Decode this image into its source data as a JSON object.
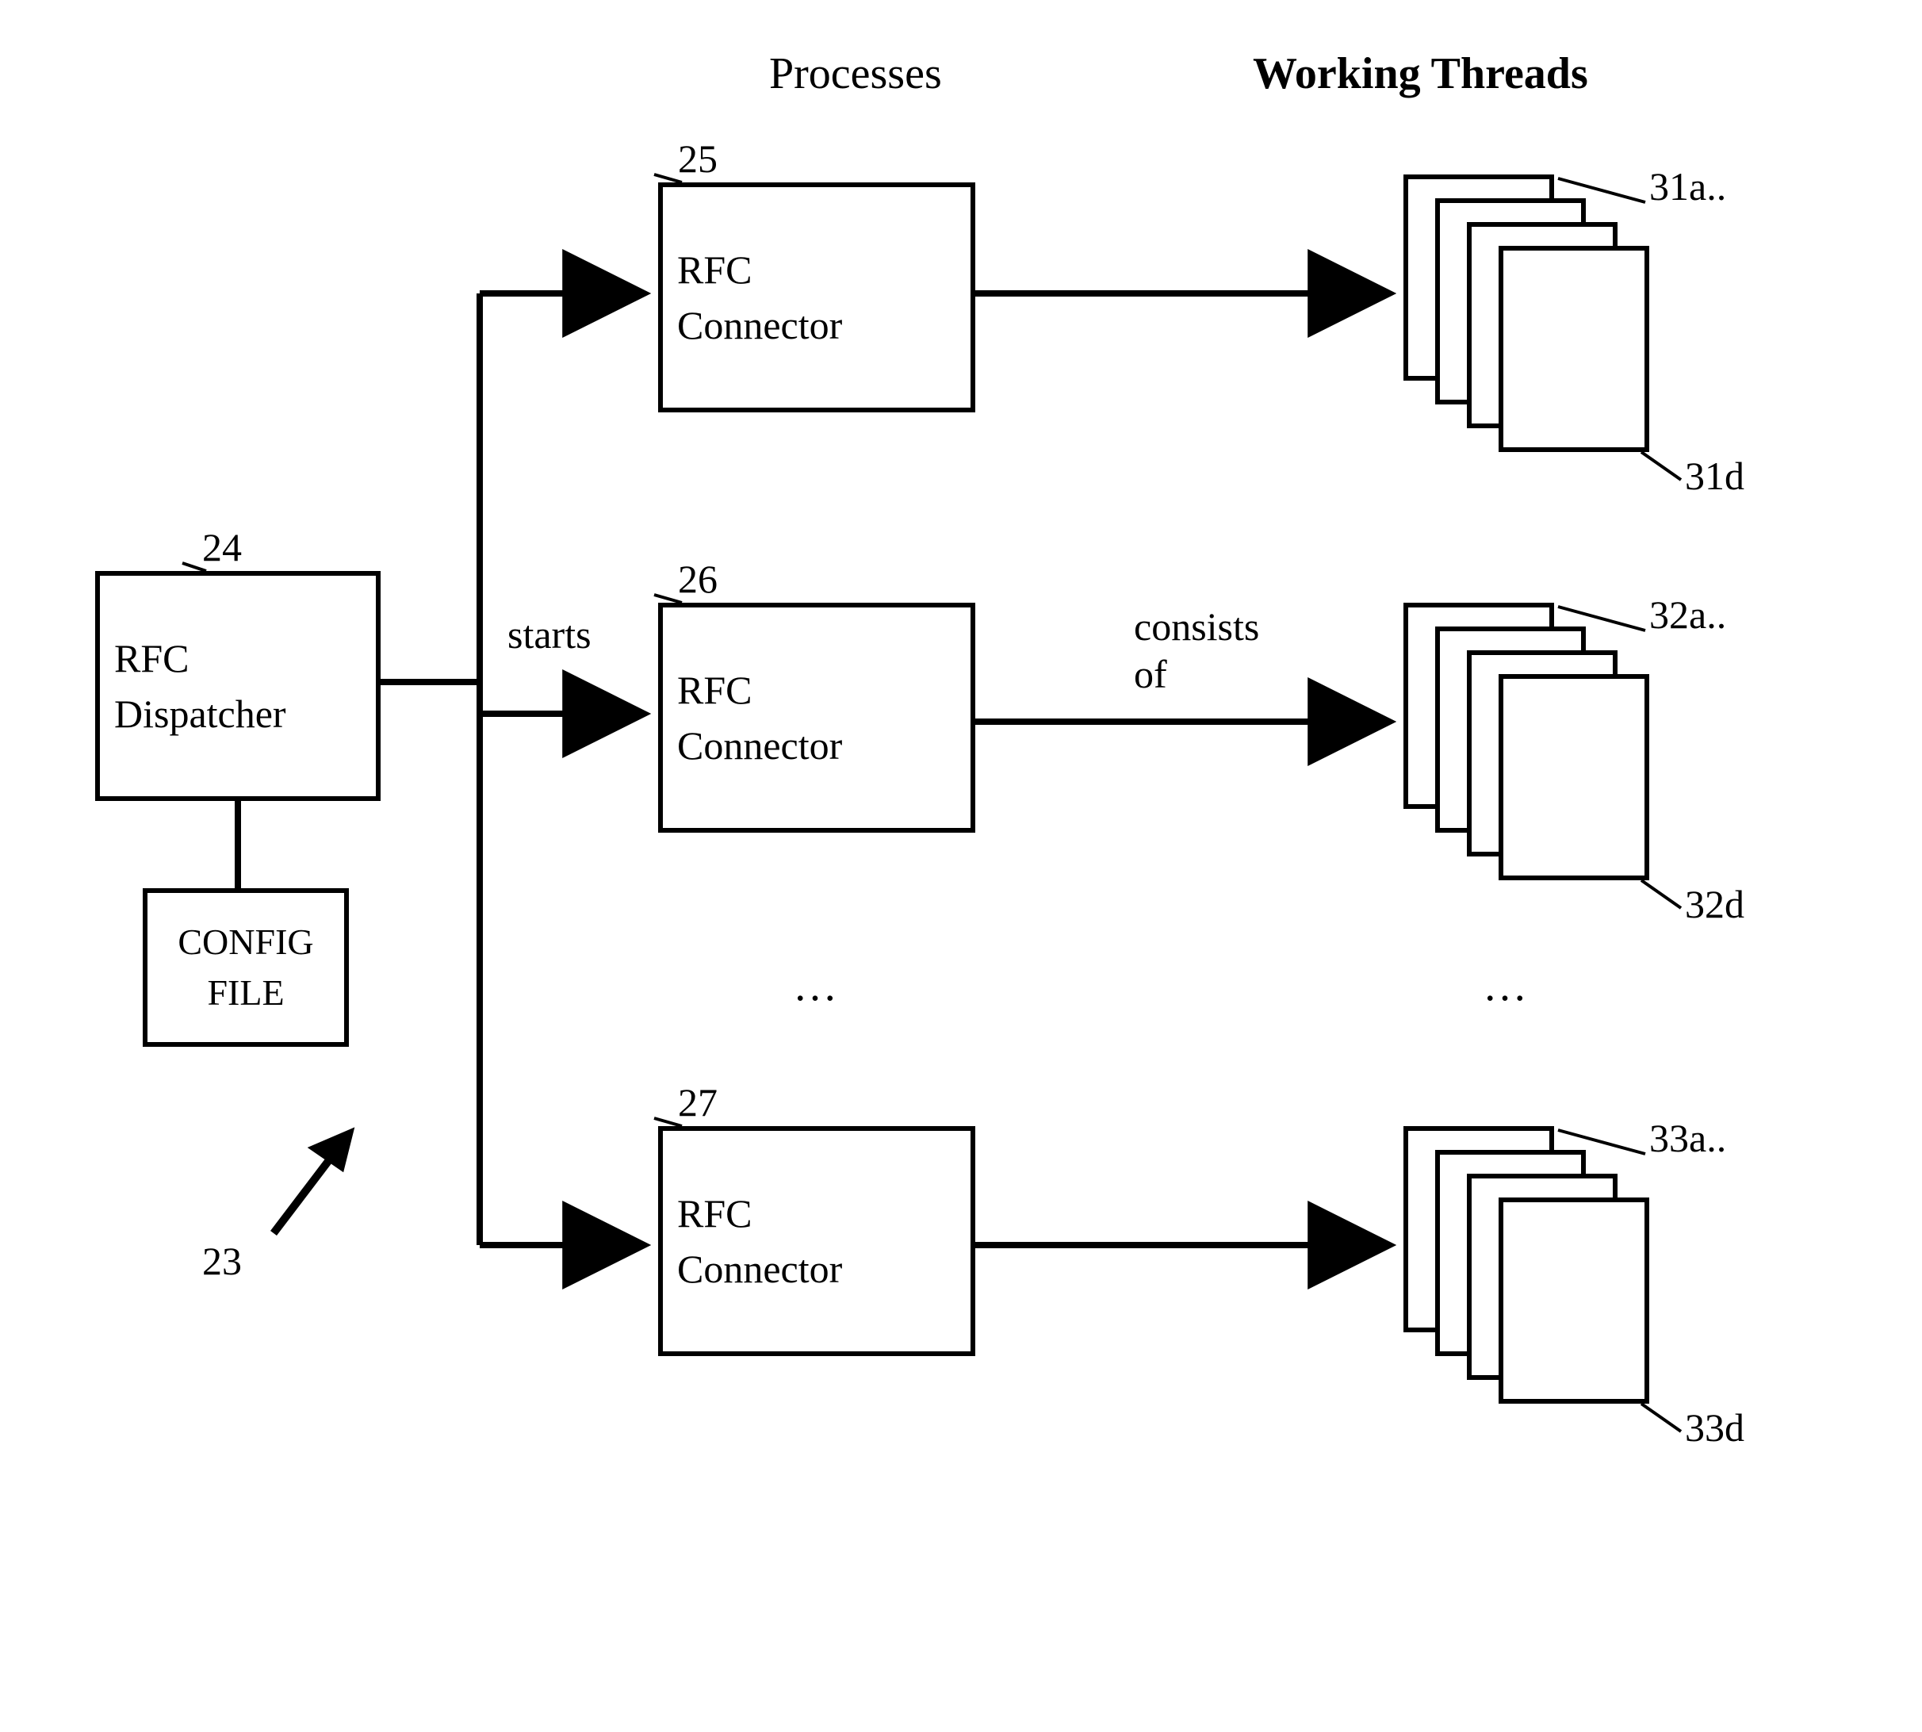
{
  "headers": {
    "processes": "Processes",
    "working_threads": "Working Threads"
  },
  "dispatcher": {
    "line1": "RFC",
    "line2": "Dispatcher",
    "ref": "24"
  },
  "config_file": {
    "line1": "CONFIG",
    "line2": "FILE"
  },
  "connectors": [
    {
      "line1": "RFC",
      "line2": "Connector",
      "ref": "25"
    },
    {
      "line1": "RFC",
      "line2": "Connector",
      "ref": "26"
    },
    {
      "line1": "RFC",
      "line2": "Connector",
      "ref": "27"
    }
  ],
  "arrows": {
    "starts": "starts",
    "consists_of": "consists\nof"
  },
  "threads": [
    {
      "first": "31a..",
      "last": "31d"
    },
    {
      "first": "32a..",
      "last": "32d"
    },
    {
      "first": "33a..",
      "last": "33d"
    }
  ],
  "figure_ref": "23",
  "ellipsis": "…"
}
